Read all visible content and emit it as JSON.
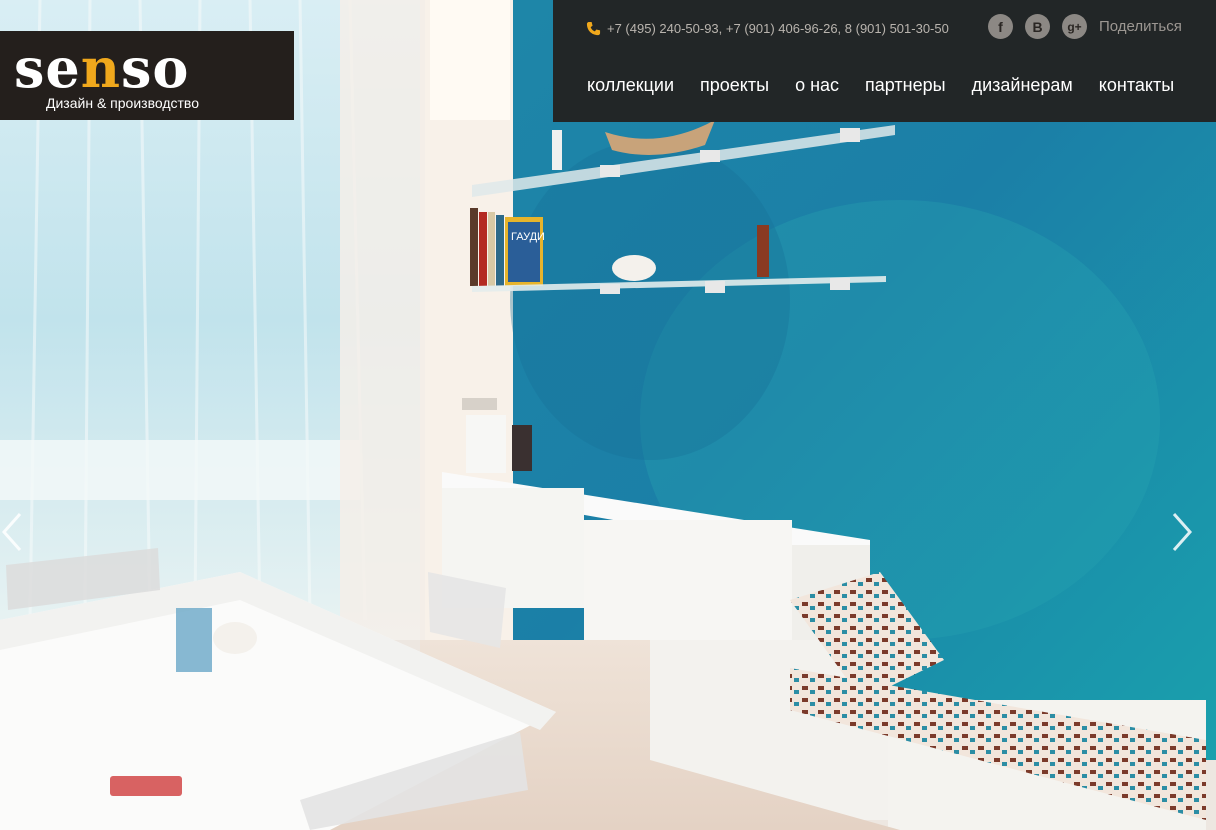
{
  "brand": {
    "logo_prefix": "se",
    "logo_accent": "n",
    "logo_suffix": "so",
    "tagline": "Дизайн & производство",
    "accent_color": "#f0a81c"
  },
  "contacts": {
    "phones": "+7 (495) 240-50-93, +7 (901) 406-96-26, 8 (901) 501-30-50",
    "icon": "phone-icon"
  },
  "social": {
    "items": [
      {
        "name": "facebook",
        "glyph": "f"
      },
      {
        "name": "vkontakte",
        "glyph": "B"
      },
      {
        "name": "google-plus",
        "glyph": "g+"
      }
    ],
    "share_label": "Поделиться"
  },
  "menu": {
    "items": [
      {
        "label": "коллекции"
      },
      {
        "label": "проекты"
      },
      {
        "label": "о нас"
      },
      {
        "label": "партнеры"
      },
      {
        "label": "дизайнерам"
      },
      {
        "label": "контакты"
      }
    ]
  },
  "slider": {
    "prev_icon": "chevron-left-icon",
    "next_icon": "chevron-right-icon"
  },
  "photo": {
    "book_spine": "ГАУДИ",
    "wall_color": "#1f8fb0"
  }
}
